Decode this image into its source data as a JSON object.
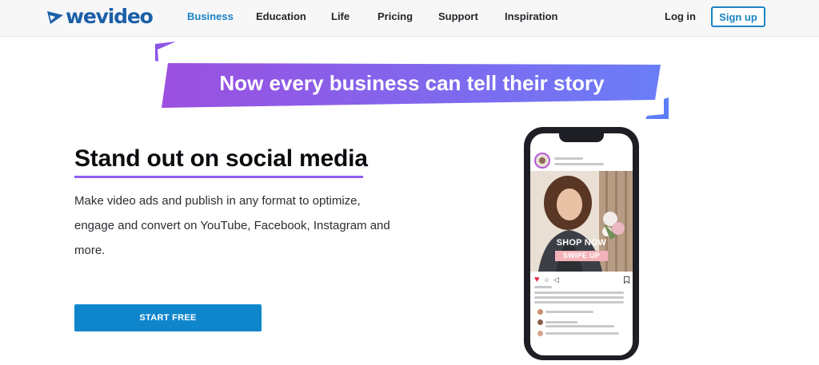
{
  "brand": {
    "name": "wevideo",
    "color": "#1b5fa8"
  },
  "nav": {
    "items": [
      {
        "label": "Business",
        "active": true
      },
      {
        "label": "Education",
        "active": false
      },
      {
        "label": "Life",
        "active": false
      },
      {
        "label": "Pricing",
        "active": false
      },
      {
        "label": "Support",
        "active": false
      },
      {
        "label": "Inspiration",
        "active": false
      }
    ],
    "login_label": "Log in",
    "signup_label": "Sign up"
  },
  "banner": {
    "text": "Now every business can tell their story"
  },
  "hero": {
    "headline": "Stand out on social media",
    "description": "Make video ads and publish in any format to optimize, engage and convert on YouTube, Facebook, Instagram and more.",
    "cta_label": "START FREE"
  },
  "phone_post": {
    "overlay_title": "SHOP NOW",
    "overlay_badge": "SWIPE UP"
  },
  "colors": {
    "accent": "#1a84c7",
    "cta": "#0f86cc",
    "banner_gradient": [
      "#9b59e6",
      "#5f7df7"
    ],
    "underline": "#8e5ff5"
  },
  "icons": [
    "wevideo-logo-icon",
    "heart-icon",
    "comment-icon",
    "share-icon",
    "bookmark-icon"
  ]
}
